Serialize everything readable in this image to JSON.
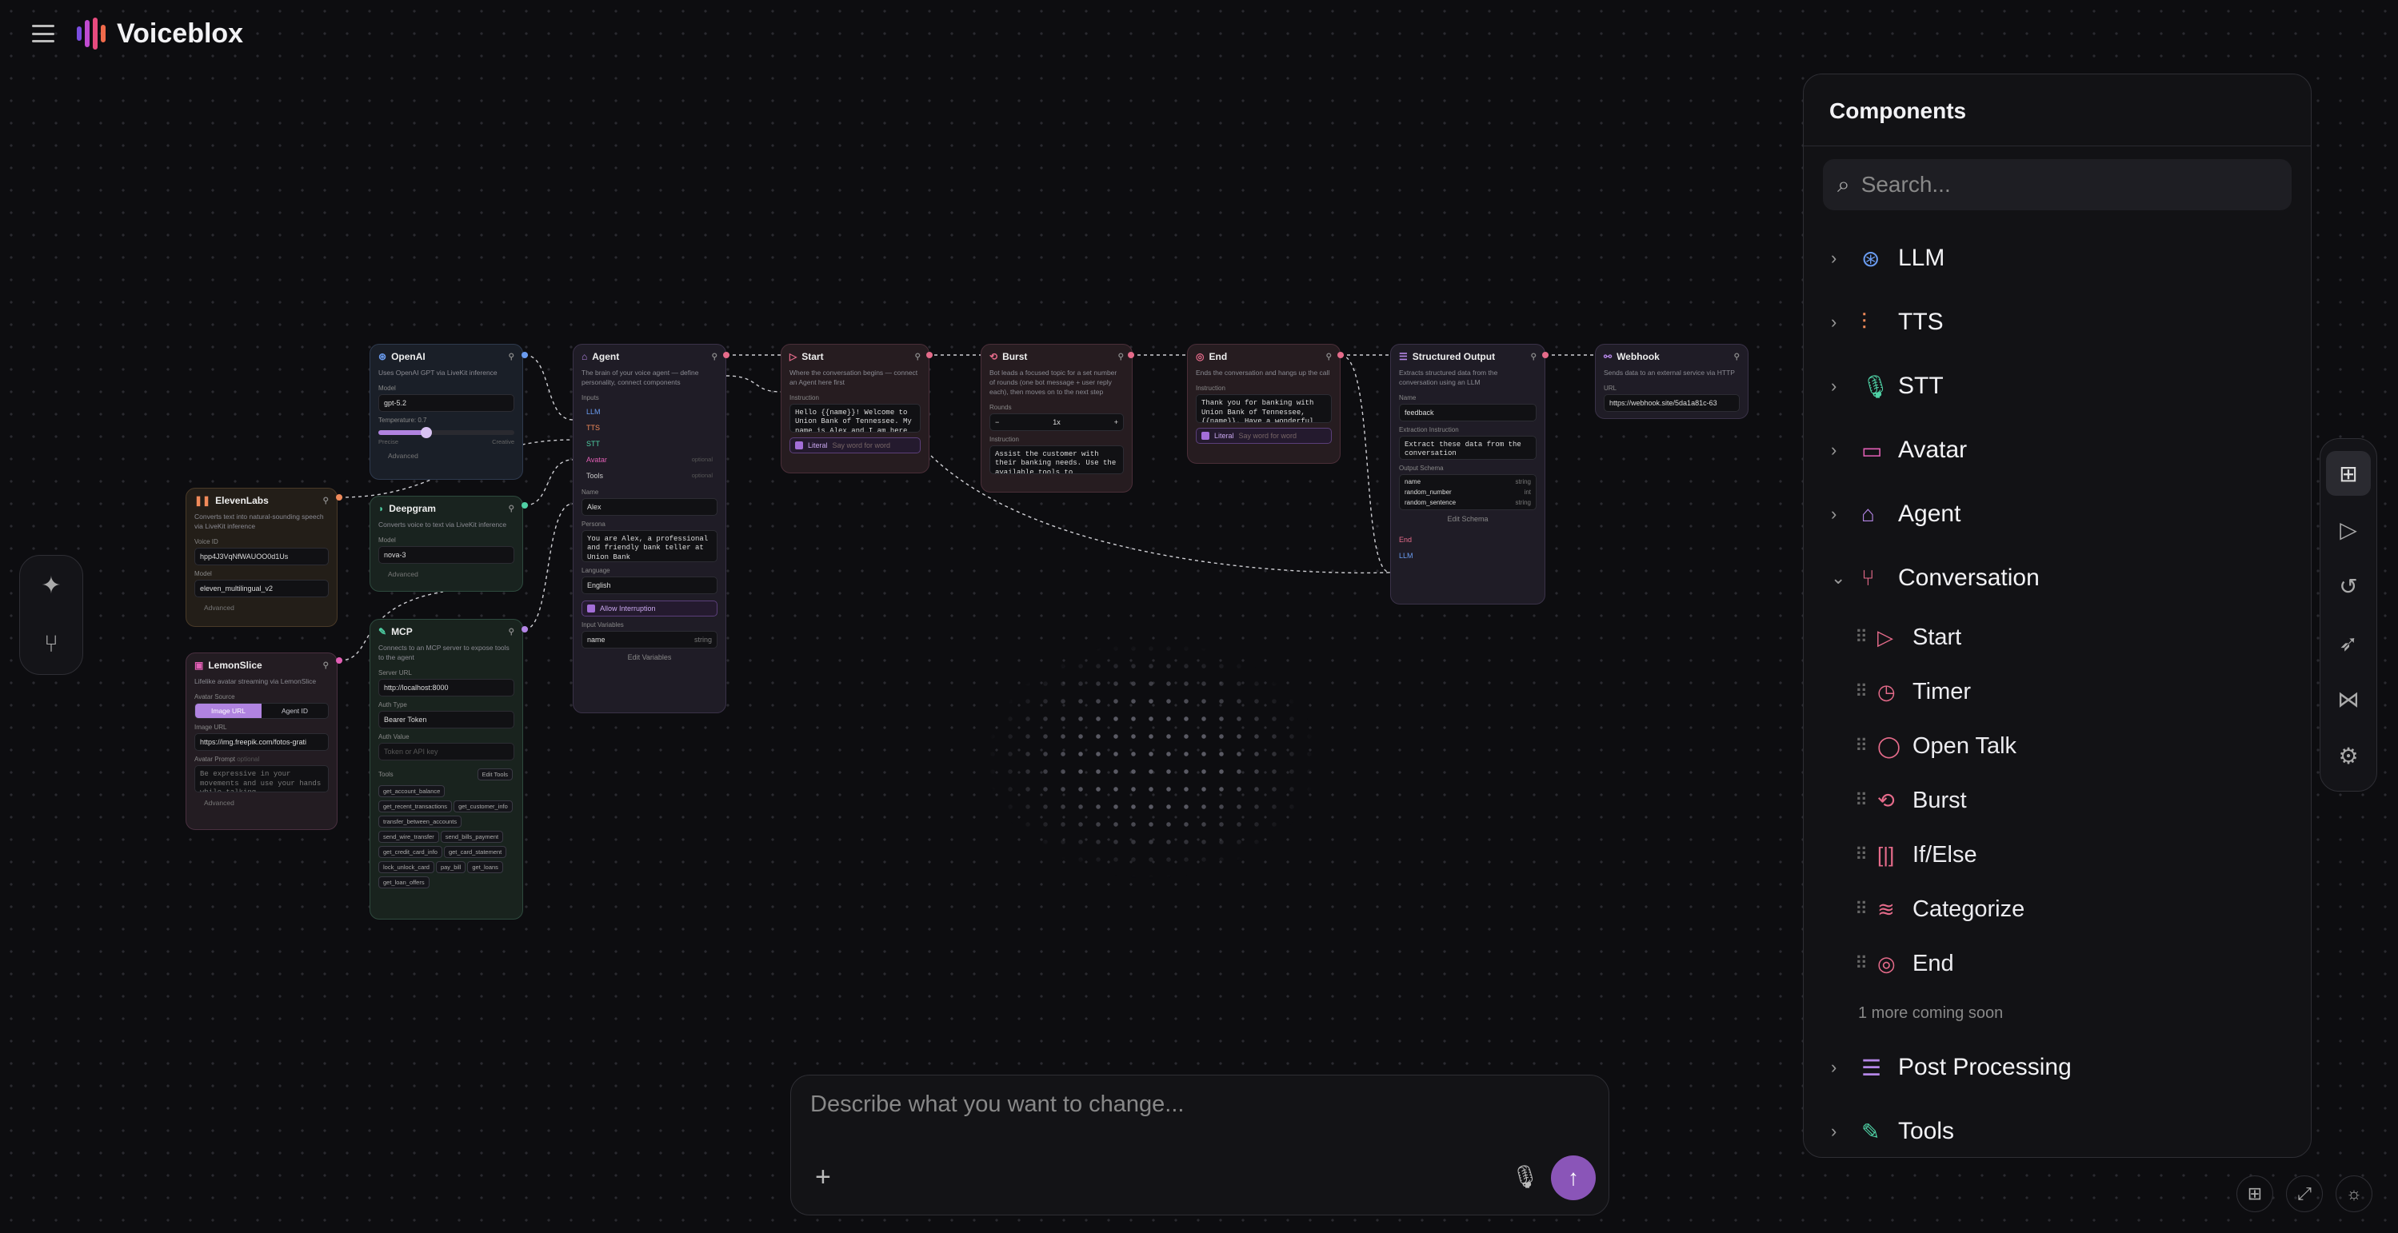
{
  "app": {
    "title": "Voiceblox"
  },
  "colors": {
    "accent": "#a36ed8",
    "send": "#8a55b8",
    "conversation_icons": "#e56b8a",
    "logo": [
      "#7a4de0",
      "#c04bd0",
      "#e64b7e",
      "#f06a4b"
    ]
  },
  "panel": {
    "title": "Components",
    "search_placeholder": "Search...",
    "categories_top": [
      {
        "label": "LLM",
        "icon": "brain-icon",
        "color": "#6a9cf0"
      },
      {
        "label": "TTS",
        "icon": "waveform-icon",
        "color": "#f08a5a"
      },
      {
        "label": "STT",
        "icon": "mic-icon",
        "color": "#4fd1a5"
      },
      {
        "label": "Avatar",
        "icon": "video-icon",
        "color": "#e25fb5"
      },
      {
        "label": "Agent",
        "icon": "robot-icon",
        "color": "#b486e6"
      },
      {
        "label": "Conversation",
        "icon": "branch-icon",
        "color": "#e56b8a"
      }
    ],
    "conversation_items": [
      {
        "label": "Start",
        "icon": "play-icon"
      },
      {
        "label": "Timer",
        "icon": "clock-icon"
      },
      {
        "label": "Open Talk",
        "icon": "chat-bubble-icon"
      },
      {
        "label": "Burst",
        "icon": "repeat-icon"
      },
      {
        "label": "If/Else",
        "icon": "split-icon"
      },
      {
        "label": "Categorize",
        "icon": "layers-icon"
      },
      {
        "label": "End",
        "icon": "target-icon"
      }
    ],
    "more_coming": "1 more coming soon",
    "categories_bottom": [
      {
        "label": "Post Processing",
        "icon": "list-process-icon",
        "color": "#b486e6"
      },
      {
        "label": "Tools",
        "icon": "wrench-icon",
        "color": "#4fd1a5"
      }
    ]
  },
  "chat": {
    "placeholder": "Describe what you want to change..."
  },
  "nodes": {
    "openai": {
      "title": "OpenAI",
      "desc": "Uses OpenAI GPT via LiveKit inference",
      "model_label": "Model",
      "model": "gpt-5.2",
      "temp_label": "Temperature: 0.7",
      "temperature": 0.7,
      "precise": "Precise",
      "creative": "Creative",
      "advanced": "Advanced"
    },
    "elevenlabs": {
      "title": "ElevenLabs",
      "desc": "Converts text into natural-sounding speech via LiveKit inference",
      "voice_label": "Voice ID",
      "voice": "hpp4J3VqNfWAUOO0d1Us",
      "model_label": "Model",
      "model": "eleven_multilingual_v2",
      "advanced": "Advanced"
    },
    "deepgram": {
      "title": "Deepgram",
      "desc": "Converts voice to text via LiveKit inference",
      "model_label": "Model",
      "model": "nova-3",
      "advanced": "Advanced"
    },
    "lemonslice": {
      "title": "LemonSlice",
      "desc": "Lifelike avatar streaming via LemonSlice",
      "source_label": "Avatar Source",
      "opt1": "Image URL",
      "opt2": "Agent ID",
      "url_label": "Image URL",
      "url": "https://img.freepik.com/fotos-grati",
      "prompt_label": "Avatar Prompt",
      "optional": "optional",
      "prompt": "Be expressive in your movements and use your hands while talking.",
      "advanced": "Advanced"
    },
    "mcp": {
      "title": "MCP",
      "desc": "Connects to an MCP server to expose tools to the agent",
      "server_label": "Server URL",
      "server": "http://localhost:8000",
      "auth_label": "Auth Type",
      "auth": "Bearer Token",
      "authval_label": "Auth Value",
      "authval_ph": "Token or API key",
      "tools_label": "Tools",
      "edit_tools": "Edit Tools",
      "tools": [
        "get_account_balance",
        "get_recent_transactions",
        "get_customer_info",
        "transfer_between_accounts",
        "send_wire_transfer",
        "send_bills_payment",
        "get_credit_card_info",
        "get_card_statement",
        "lock_unlock_card",
        "pay_bill",
        "get_loans",
        "get_loan_offers"
      ]
    },
    "agent": {
      "title": "Agent",
      "desc": "The brain of your voice agent — define personality, connect components",
      "inputs_label": "Inputs",
      "inputs": [
        {
          "label": "LLM",
          "color": "#6a9cf0"
        },
        {
          "label": "TTS",
          "color": "#f08a5a"
        },
        {
          "label": "STT",
          "color": "#4fd1a5"
        },
        {
          "label": "Avatar",
          "color": "#e25fb5",
          "note": "optional"
        },
        {
          "label": "Tools",
          "color": "#cccccc",
          "note": "optional"
        }
      ],
      "name_label": "Name",
      "name": "Alex",
      "persona_label": "Persona",
      "persona": "You are Alex, a professional and friendly bank teller at Union Bank",
      "lang_label": "Language",
      "language": "English",
      "interrupt": "Allow Interruption",
      "vars_label": "Input Variables",
      "var_name": "name",
      "var_type": "string",
      "edit_vars": "Edit Variables"
    },
    "start": {
      "title": "Start",
      "desc": "Where the conversation begins — connect an Agent here first",
      "instr_label": "Instruction",
      "instruction": "Hello {{name}}! Welcome to Union Bank of Tennessee. My name is Alex and I am here",
      "literal": "Literal",
      "literal_note": "Say word for word"
    },
    "burst": {
      "title": "Burst",
      "desc": "Bot leads a focused topic for a set number of rounds (one bot message + user reply each), then moves on to the next step",
      "rounds_label": "Rounds",
      "rounds": "1x",
      "instr_label": "Instruction",
      "instruction": "Assist the customer with their banking needs. Use the available tools to"
    },
    "end": {
      "title": "End",
      "desc": "Ends the conversation and hangs up the call",
      "instr_label": "Instruction",
      "instruction": "Thank you for banking with Union Bank of Tennessee, {{name}}. Have a wonderful",
      "literal": "Literal",
      "literal_note": "Say word for word"
    },
    "structured": {
      "title": "Structured Output",
      "desc": "Extracts structured data from the conversation using an LLM",
      "name_label": "Name",
      "name": "feedback",
      "instr_label": "Extraction Instruction",
      "instruction": "Extract these data from the conversation",
      "schema_label": "Output Schema",
      "schema": [
        {
          "k": "name",
          "t": "string"
        },
        {
          "k": "random_number",
          "t": "int"
        },
        {
          "k": "random_sentence",
          "t": "string"
        }
      ],
      "edit_schema": "Edit Schema",
      "port_end": "End",
      "port_llm": "LLM"
    },
    "webhook": {
      "title": "Webhook",
      "desc": "Sends data to an external service via HTTP",
      "url_label": "URL",
      "url": "https://webhook.site/5da1a81c-63"
    }
  }
}
